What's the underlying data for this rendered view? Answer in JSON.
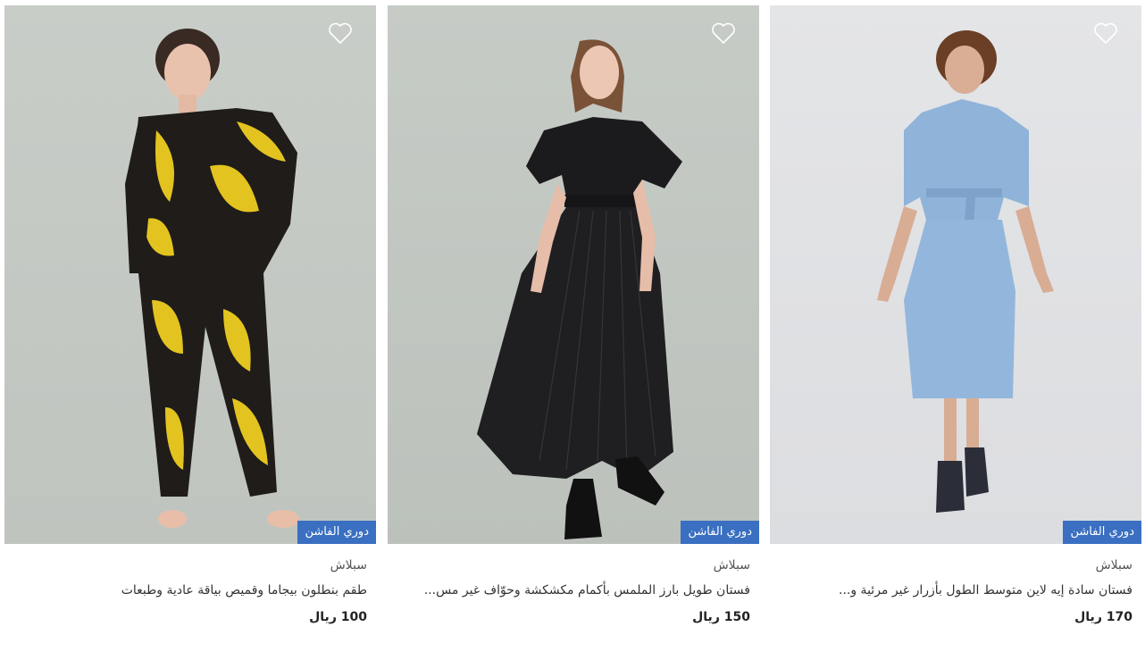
{
  "products": [
    {
      "badge": "دوري الفاشن",
      "brand": "سبلاش",
      "title": "طقم بنطلون بيجاما وقميص بياقة عادية وطبعات",
      "price": "100 ريال",
      "wishlist_icon": "heart-outline-icon"
    },
    {
      "badge": "دوري الفاشن",
      "brand": "سبلاش",
      "title": "فستان طويل بارز الملمس بأكمام مكشكشة وحوّاف غير مس...",
      "price": "150 ريال",
      "wishlist_icon": "heart-outline-icon"
    },
    {
      "badge": "دوري الفاشن",
      "brand": "سبلاش",
      "title": "فستان سادة إيه لاين متوسط الطول بأزرار غير مرئية و...",
      "price": "170 ريال",
      "wishlist_icon": "heart-outline-icon"
    }
  ],
  "colors": {
    "badge_bg": "#3a6fc1",
    "badge_text": "#ffffff",
    "price_text": "#222222"
  }
}
